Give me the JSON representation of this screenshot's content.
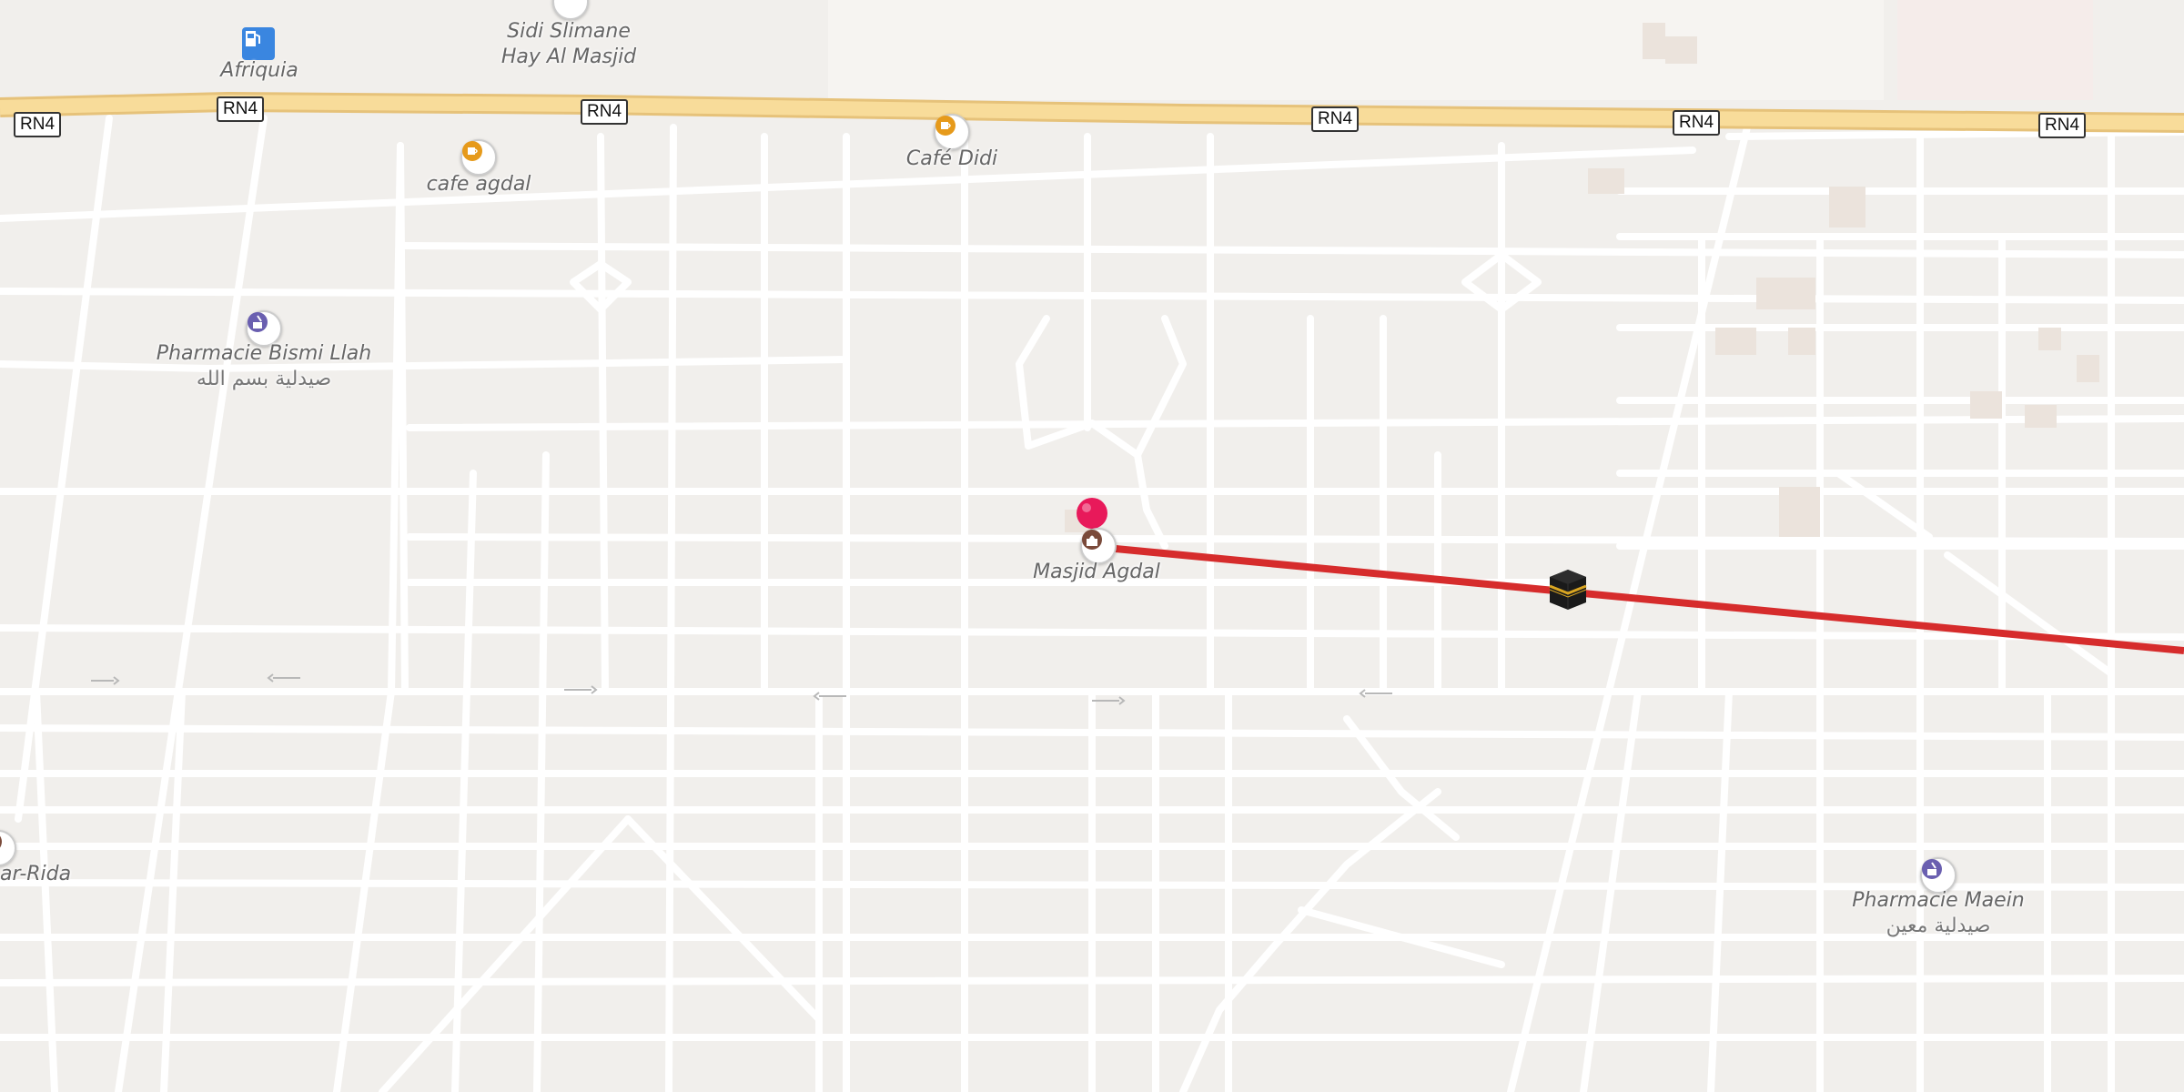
{
  "map": {
    "roads": [
      {
        "ref": "RN4"
      },
      {
        "ref": "RN4"
      },
      {
        "ref": "RN4"
      },
      {
        "ref": "RN4"
      },
      {
        "ref": "RN4"
      },
      {
        "ref": "RN4"
      }
    ],
    "pois": {
      "afriquia": {
        "name": "Afriquia",
        "icon": "fuel-icon"
      },
      "sidi_slimane": {
        "name": "Sidi Slimane",
        "sub": "Hay Al Masjid",
        "icon": "mail-icon"
      },
      "cafe_agdal": {
        "name": "cafe agdal",
        "icon": "cafe-icon"
      },
      "cafe_didi": {
        "name": "Café Didi",
        "icon": "cafe-icon"
      },
      "pharmacie_bismi": {
        "name": "Pharmacie Bismi Llah",
        "sub": "صيدلية بسم الله",
        "icon": "pharmacy-icon"
      },
      "masjid_agdal": {
        "name": "Masjid Agdal",
        "icon": "mosque-icon"
      },
      "pharmacie_maein": {
        "name": "Pharmacie Maein",
        "sub": "صيدلية معين",
        "icon": "pharmacy-icon"
      },
      "partial_left": {
        "name": "ar-Rida",
        "icon": "mosque-icon"
      }
    },
    "qibla_line_color": "#d62c2c",
    "pin_color": "#e8195a",
    "kaaba_icon": "kaaba-icon",
    "highway_color": "#f8dc9a"
  }
}
